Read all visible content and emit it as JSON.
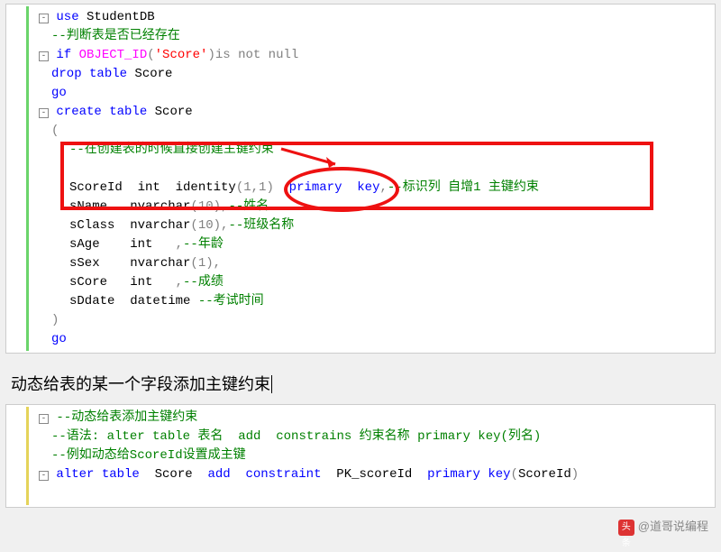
{
  "block1": {
    "l1_use": "use",
    "l1_db": " StudentDB",
    "l2_comment": "--判断表是否已经存在",
    "l3_if": "if",
    "l3_fn": " OBJECT_ID",
    "l3_paren_open": "(",
    "l3_str": "'Score'",
    "l3_paren_close": ")",
    "l3_isnotnull": "is not null",
    "l4_drop": "drop",
    "l4_table": " table",
    "l4_score": " Score",
    "l5_go": "go",
    "l6_create": "create",
    "l6_table": " table",
    "l6_score": " Score",
    "l7_paren": "(",
    "l8_comment": "--在创建表的时候直接创建主键约束",
    "l10_scoreid": "ScoreId  int  identity",
    "l10_args": "(1,1)",
    "l10_pk": "  primary  key",
    "l10_comma": ",",
    "l10_comment": "--标识列 自增1 主键约束",
    "l11_sname": "sName   nvarchar",
    "l11_args": "(10),",
    "l11_comment": "--姓名",
    "l12_sclass": "sClass  nvarchar",
    "l12_args": "(10),",
    "l12_comment": "--班级名称",
    "l13_sage": "sAge    int   ",
    "l13_comma": ",",
    "l13_comment": "--年龄",
    "l14_ssex": "sSex    nvarchar",
    "l14_args": "(1),",
    "l15_score": "sCore   int   ",
    "l15_comma": ",",
    "l15_comment": "--成绩",
    "l16_sddate": "sDdate  datetime ",
    "l16_comment": "--考试时间",
    "l17_paren": ")",
    "l18_go": "go"
  },
  "caption": "动态给表的某一个字段添加主键约束",
  "block2": {
    "l1_comment": "--动态给表添加主键约束",
    "l2_prefix": "--语法: ",
    "l2_alter": "alter table",
    "l2_tname": " 表名  ",
    "l2_add": "add  constrains",
    "l2_cname": " 约束名称 ",
    "l2_pk": "primary key",
    "l2_col": "(列名)",
    "l3_comment": "--例如动态给ScoreId设置成主键",
    "l4_alter": "alter table",
    "l4_score": "  Score  ",
    "l4_add": "add  constraint",
    "l4_pkid": "  PK_scoreId  ",
    "l4_pk": "primary key",
    "l4_open": "(",
    "l4_col": "ScoreId",
    "l4_close": ")"
  },
  "attribution": {
    "icon": "头条",
    "text": "@道哥说编程"
  }
}
